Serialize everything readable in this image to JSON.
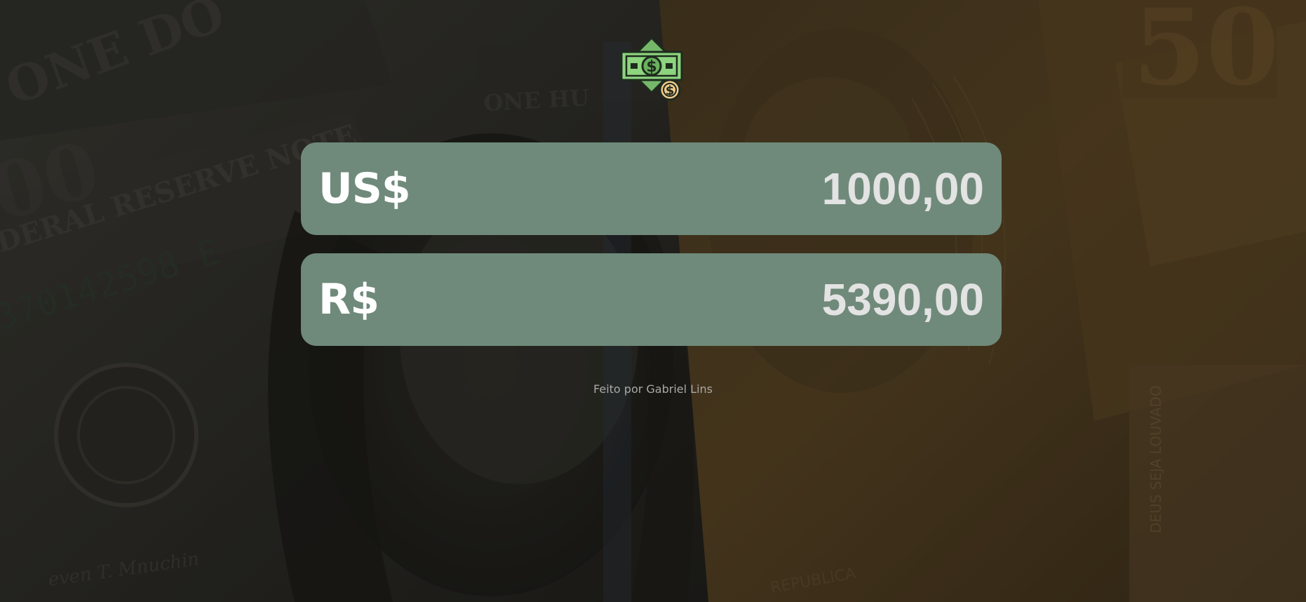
{
  "app": {
    "logo_icon": "money-exchange-icon",
    "accent": "#6f8a7a"
  },
  "converter": {
    "from": {
      "label": "US$",
      "value": "1000,00"
    },
    "to": {
      "label": "R$",
      "value": "5390,00"
    }
  },
  "footer": {
    "credit": "Feito por Gabriel Lins"
  }
}
